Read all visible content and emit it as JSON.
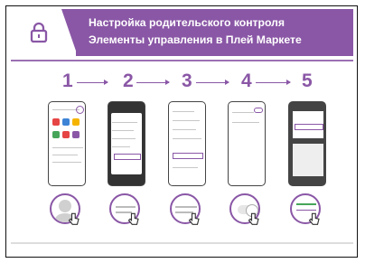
{
  "header": {
    "line1": "Настройка родительского контроля",
    "line2": "Элементы управления в Плей Маркете"
  },
  "steps": [
    "1",
    "2",
    "3",
    "4",
    "5"
  ],
  "colors": {
    "accent": "#8a57a6",
    "red": "#e64545",
    "green": "#46a55a",
    "gray": "#c7c7c7"
  },
  "zooms": [
    {
      "name": "avatar-zoom"
    },
    {
      "name": "play-menu-zoom"
    },
    {
      "name": "settings-zoom"
    },
    {
      "name": "toggle-zoom"
    },
    {
      "name": "pin-zoom"
    }
  ]
}
